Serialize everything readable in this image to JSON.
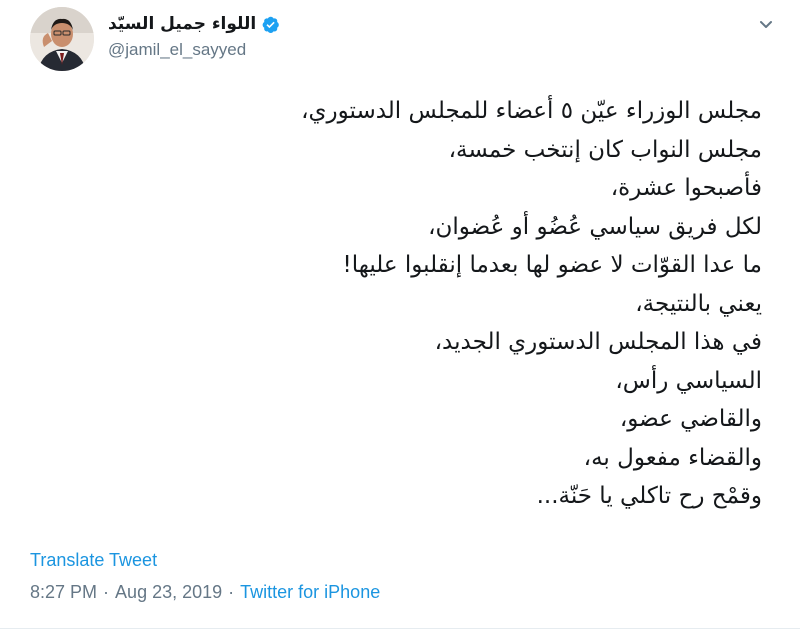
{
  "author": {
    "display_name": "اللواء جميل السيّد",
    "handle": "@jamil_el_sayyed",
    "verified_icon": "verified-badge-icon"
  },
  "tweet": {
    "lines": [
      "مجلس الوزراء عيّن ٥ أعضاء للمجلس الدستوري،",
      "مجلس النواب كان إنتخب خمسة،",
      "فأصبحوا عشرة،",
      "لكل فريق سياسي عُضُو أو عُضوان،",
      "ما عدا القوّات لا عضو لها بعدما إنقلبوا عليها!",
      "يعني بالنتيجة،",
      "في هذا المجلس الدستوري الجديد،",
      "السياسي رأس،",
      "والقاضي عضو،",
      "والقضاء مفعول به،",
      "وقمْح رح تاكلي يا حَنّة..."
    ]
  },
  "actions": {
    "translate_label": "Translate Tweet"
  },
  "meta": {
    "time": "8:27 PM",
    "separator": "·",
    "date": "Aug 23, 2019",
    "source": "Twitter for iPhone"
  },
  "colors": {
    "link": "#1b95e0",
    "muted": "#657786",
    "text": "#14171a"
  }
}
